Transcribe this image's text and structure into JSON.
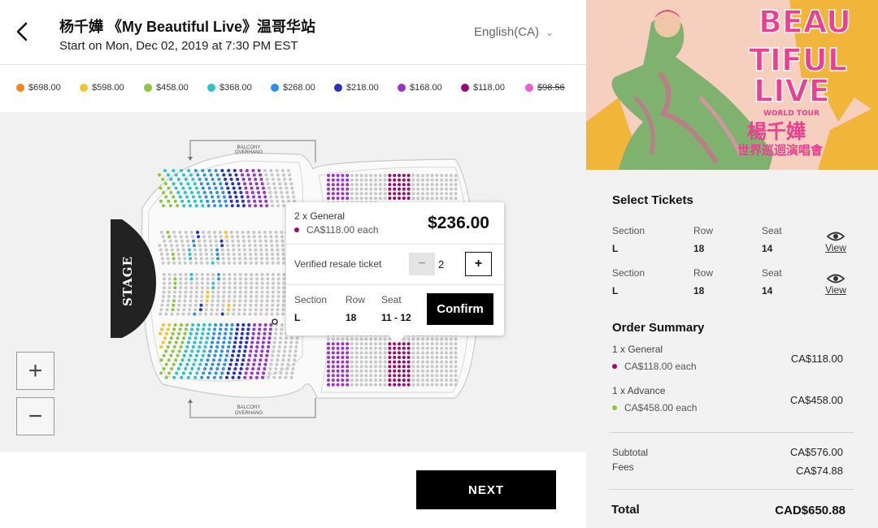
{
  "header": {
    "title": "杨千嬅 《My Beautiful Live》温哥华站",
    "date": "Start on Mon, Dec 02, 2019 at 7:30 PM EST",
    "language": "English(CA)"
  },
  "legend": [
    {
      "label": "$698.00",
      "color": "#f0861e",
      "strike": false
    },
    {
      "label": "$598.00",
      "color": "#f4c52c",
      "strike": false
    },
    {
      "label": "$458.00",
      "color": "#8cc63f",
      "strike": false
    },
    {
      "label": "$368.00",
      "color": "#29c3c9",
      "strike": false
    },
    {
      "label": "$268.00",
      "color": "#2e8ef0",
      "strike": false
    },
    {
      "label": "$218.00",
      "color": "#2332c4",
      "strike": false
    },
    {
      "label": "$168.00",
      "color": "#9b33c9",
      "strike": false
    },
    {
      "label": "$118.00",
      "color": "#9c0a6e",
      "strike": false
    },
    {
      "label": "$98.56",
      "color": "#f25bd0",
      "strike": true
    }
  ],
  "map": {
    "stage_label": "STAGE",
    "balcony_top": [
      "BALCONY",
      "OVERHANG"
    ],
    "balcony_bottom": [
      "BALCONY",
      "OVERHANG"
    ],
    "zoom_in": "+",
    "zoom_out": "−"
  },
  "popup": {
    "quantity_label": "2 x General",
    "each_label": "CA$118.00 each",
    "total": "$236.00",
    "resale_label": "Verified resale ticket",
    "minus": "−",
    "count": "2",
    "plus": "+",
    "section_h": "Section",
    "row_h": "Row",
    "seat_h": "Seat",
    "section_v": "L",
    "row_v": "18",
    "seat_v": "11 - 12",
    "confirm": "Confirm"
  },
  "footer": {
    "next": "NEXT"
  },
  "poster": {
    "title_lines": [
      "BEAU",
      "TIFUL",
      "LIVE"
    ],
    "subtitle": "WORLD TOUR",
    "artist": "楊千嬅",
    "tagline": "世界巡迴演唱會"
  },
  "select_tickets": {
    "title": "Select Tickets",
    "tickets": [
      {
        "section_h": "Section",
        "row_h": "Row",
        "seat_h": "Seat",
        "section": "L",
        "row": "18",
        "seat": "14",
        "view": "View"
      },
      {
        "section_h": "Section",
        "row_h": "Row",
        "seat_h": "Seat",
        "section": "L",
        "row": "18",
        "seat": "14",
        "view": "View"
      }
    ]
  },
  "order_summary": {
    "title": "Order Summary",
    "items": [
      {
        "label": "1 x General",
        "each": "CA$118.00 each",
        "price": "CA$118.00",
        "color": "#9c0a6e"
      },
      {
        "label": "1 x Advance",
        "each": "CA$458.00 each",
        "price": "CA$458.00",
        "color": "#8cc63f"
      }
    ],
    "subtotal_label": "Subtotal",
    "subtotal": "CA$576.00",
    "fees_label": "Fees",
    "fees": "CA$74.88",
    "total_label": "Total",
    "total": "CAD$650.88"
  }
}
